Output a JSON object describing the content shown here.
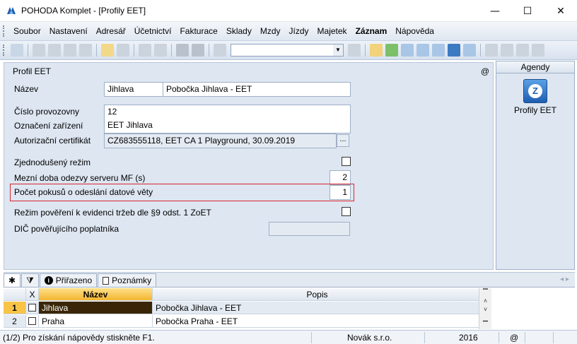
{
  "window": {
    "title": "POHODA Komplet - [Profily EET]",
    "controls": {
      "minimize": "—",
      "maximize": "☐",
      "close": "✕"
    }
  },
  "menu": {
    "items": [
      "Soubor",
      "Nastavení",
      "Adresář",
      "Účetnictví",
      "Fakturace",
      "Sklady",
      "Mzdy",
      "Jízdy",
      "Majetek",
      "Záznam",
      "Nápověda"
    ],
    "active_index": 9
  },
  "form": {
    "section_title": "Profil EET",
    "at_sign": "@",
    "nazev_label": "Název",
    "nazev_value": "Jihlava",
    "nazev_detail": "Pobočka Jihlava - EET",
    "cislo_label": "Číslo provozovny",
    "cislo_value": "12",
    "oznaceni_label": "Označení zařízení",
    "oznaceni_value": "EET Jihlava",
    "certifikat_label": "Autorizační certifikát",
    "certifikat_value": "CZ683555118, EET CA 1 Playground, 30.09.2019",
    "certifikat_button": "...",
    "zjednoduseny_label": "Zjednodušený režim",
    "zjednoduseny_checked": false,
    "mezni_label": "Mezní doba odezvy serveru MF (s)",
    "mezni_value": "2",
    "pokusy_label": "Počet pokusů o odeslání datové věty",
    "pokusy_value": "1",
    "poverení_label": "Režim pověření k evidenci tržeb dle §9 odst. 1 ZoET",
    "povereni_checked": false,
    "dic_label": "DIČ pověřujícího poplatníka",
    "dic_value": ""
  },
  "agendy": {
    "title": "Agendy",
    "item_label": "Profily EET"
  },
  "tabs": {
    "star": "✱",
    "filter": "",
    "prirazeno": "Přiřazeno",
    "poznamky": "Poznámky",
    "nav": "◂ ▸"
  },
  "grid": {
    "columns": {
      "x": "X",
      "nazev": "Název",
      "popis": "Popis"
    },
    "rows": [
      {
        "num": "1",
        "nazev": "Jihlava",
        "popis": "Pobočka Jihlava - EET"
      },
      {
        "num": "2",
        "nazev": "Praha",
        "popis": "Pobočka Praha - EET"
      }
    ]
  },
  "statusbar": {
    "help": "(1/2) Pro získání nápovědy stiskněte F1.",
    "company": "Novák s.r.o.",
    "year": "2016",
    "at": "@"
  },
  "colors": {
    "highlight": "#d9262e",
    "selected_row": "#3a2606",
    "sort_header": "#f2b530"
  }
}
